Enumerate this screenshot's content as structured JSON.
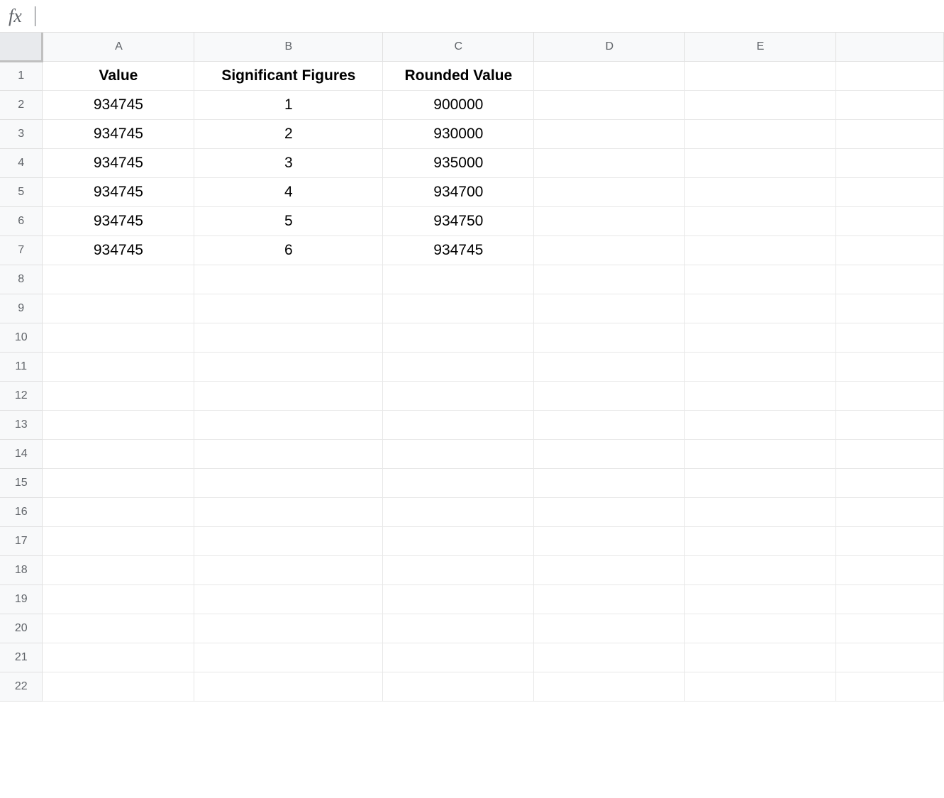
{
  "formula_bar": {
    "value": ""
  },
  "columns": [
    "A",
    "B",
    "C",
    "D",
    "E"
  ],
  "row_numbers": [
    "1",
    "2",
    "3",
    "4",
    "5",
    "6",
    "7",
    "8",
    "9",
    "10",
    "11",
    "12",
    "13",
    "14",
    "15",
    "16",
    "17",
    "18",
    "19",
    "20",
    "21",
    "22"
  ],
  "cells": {
    "A1": "Value",
    "B1": "Significant Figures",
    "C1": "Rounded Value",
    "A2": "934745",
    "B2": "1",
    "C2": "900000",
    "A3": "934745",
    "B3": "2",
    "C3": "930000",
    "A4": "934745",
    "B4": "3",
    "C4": "935000",
    "A5": "934745",
    "B5": "4",
    "C5": "934700",
    "A6": "934745",
    "B6": "5",
    "C6": "934750",
    "A7": "934745",
    "B7": "6",
    "C7": "934745"
  }
}
